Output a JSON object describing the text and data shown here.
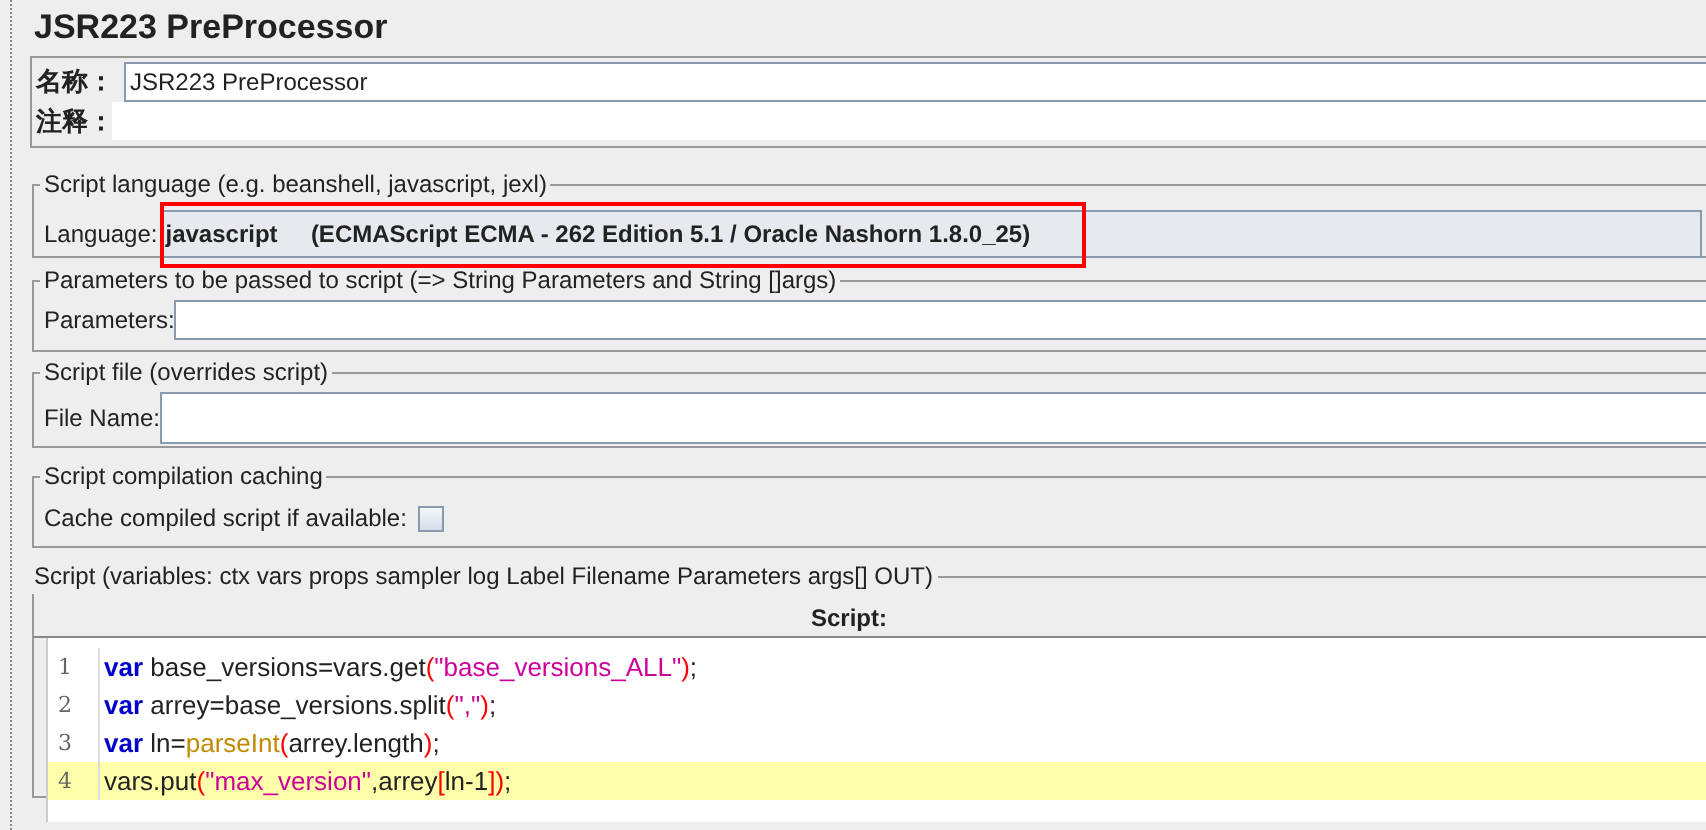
{
  "title": "JSR223 PreProcessor",
  "name_field": {
    "label": "名称：",
    "value": "JSR223 PreProcessor"
  },
  "comment_field": {
    "label": "注释："
  },
  "language_group": {
    "legend": "Script language (e.g. beanshell, javascript, jexl)",
    "label": "Language:",
    "value": "javascript",
    "description": "(ECMAScript ECMA - 262 Edition 5.1 / Oracle Nashorn 1.8.0_25)"
  },
  "parameters_group": {
    "legend": "Parameters to be passed to script (=> String Parameters and String []args)",
    "label": "Parameters:"
  },
  "file_group": {
    "legend": "Script file (overrides script)",
    "label": "File Name:"
  },
  "caching_group": {
    "legend": "Script compilation caching",
    "label": "Cache compiled script if available:",
    "checked": false
  },
  "script_group": {
    "legend": "Script (variables: ctx vars props sampler log Label Filename Parameters args[] OUT)",
    "header": "Script:",
    "lines": [
      {
        "number": "1",
        "current": false,
        "tokens": [
          {
            "kind": "keyword",
            "text": "var"
          },
          {
            "kind": "plain",
            "text": " base_versions=vars.get"
          },
          {
            "kind": "bracket",
            "text": "("
          },
          {
            "kind": "string",
            "text": "\"base_versions_ALL\""
          },
          {
            "kind": "bracket",
            "text": ")"
          },
          {
            "kind": "plain",
            "text": ";"
          }
        ]
      },
      {
        "number": "2",
        "current": false,
        "tokens": [
          {
            "kind": "keyword",
            "text": "var"
          },
          {
            "kind": "plain",
            "text": " arrey=base_versions.split"
          },
          {
            "kind": "bracket",
            "text": "("
          },
          {
            "kind": "string",
            "text": "\",\""
          },
          {
            "kind": "bracket",
            "text": ")"
          },
          {
            "kind": "plain",
            "text": ";"
          }
        ]
      },
      {
        "number": "3",
        "current": false,
        "tokens": [
          {
            "kind": "keyword",
            "text": "var"
          },
          {
            "kind": "plain",
            "text": " ln="
          },
          {
            "kind": "function",
            "text": "parseInt"
          },
          {
            "kind": "bracket",
            "text": "("
          },
          {
            "kind": "plain",
            "text": "arrey.length"
          },
          {
            "kind": "bracket",
            "text": ")"
          },
          {
            "kind": "plain",
            "text": ";"
          }
        ]
      },
      {
        "number": "4",
        "current": true,
        "tokens": [
          {
            "kind": "plain",
            "text": "vars.put"
          },
          {
            "kind": "bracket",
            "text": "("
          },
          {
            "kind": "string",
            "text": "\"max_version\""
          },
          {
            "kind": "plain",
            "text": ",arrey"
          },
          {
            "kind": "bracket",
            "text": "["
          },
          {
            "kind": "plain",
            "text": "ln-1"
          },
          {
            "kind": "bracket",
            "text": "]"
          },
          {
            "kind": "bracket",
            "text": ")"
          },
          {
            "kind": "plain",
            "text": ";"
          }
        ]
      }
    ]
  }
}
